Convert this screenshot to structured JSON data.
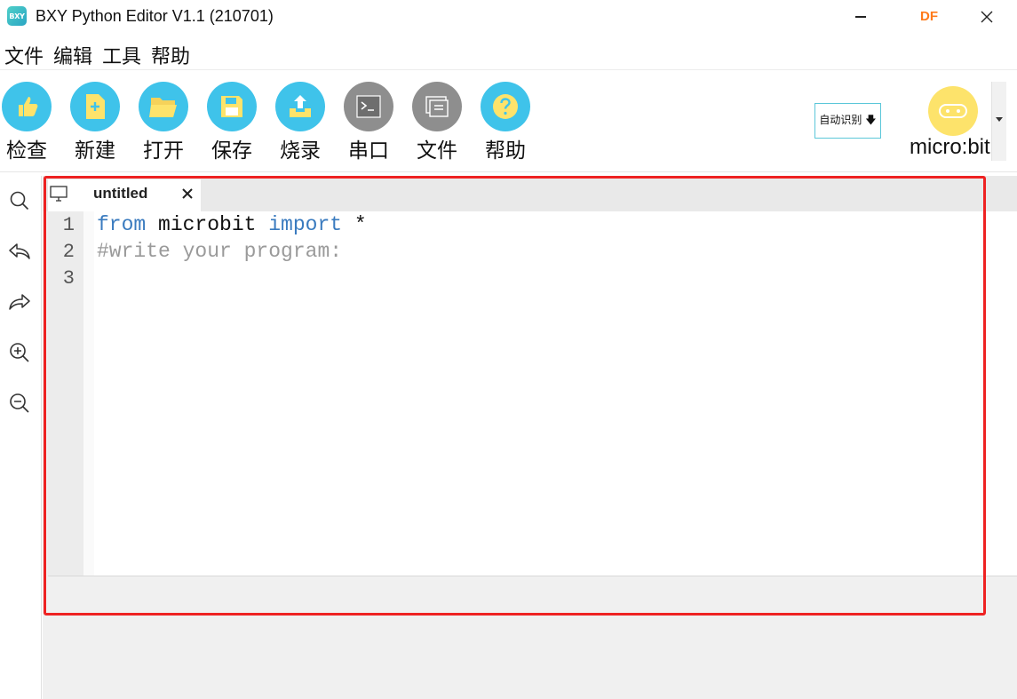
{
  "window": {
    "title": "BXY Python Editor V1.1 (210701)",
    "logo_text": "BXY",
    "badge_text": "DF"
  },
  "menu": {
    "items": [
      {
        "label": "文件"
      },
      {
        "label": "编辑"
      },
      {
        "label": "工具"
      },
      {
        "label": "帮助"
      }
    ]
  },
  "toolbar": {
    "buttons": [
      {
        "label": "检查",
        "icon": "thumbs-up-icon",
        "color": "#3fc3ea"
      },
      {
        "label": "新建",
        "icon": "new-file-icon",
        "color": "#3fc3ea"
      },
      {
        "label": "打开",
        "icon": "folder-open-icon",
        "color": "#3fc3ea"
      },
      {
        "label": "保存",
        "icon": "save-icon",
        "color": "#3fc3ea"
      },
      {
        "label": "烧录",
        "icon": "upload-icon",
        "color": "#3fc3ea"
      },
      {
        "label": "串口",
        "icon": "terminal-icon",
        "color": "#8e8e8e"
      },
      {
        "label": "文件",
        "icon": "files-icon",
        "color": "#8e8e8e"
      },
      {
        "label": "帮助",
        "icon": "help-icon",
        "color": "#3fc3ea"
      }
    ],
    "auto_detect_label": "自动识别 🡇",
    "board_label": "micro:bit"
  },
  "sidebar": {
    "tools": [
      "search-icon",
      "undo-icon",
      "redo-icon",
      "zoom-in-icon",
      "zoom-out-icon"
    ]
  },
  "editor": {
    "tab_title": "untitled",
    "line_numbers": [
      "1",
      "2",
      "3"
    ],
    "lines": {
      "l1_kw1": "from",
      "l1_mod": " microbit ",
      "l1_kw2": "import",
      "l1_rest": " *",
      "l2_comment": "#write your program:"
    }
  },
  "colors": {
    "accent_blue": "#3fc3ea",
    "keyword": "#3a7bbf",
    "comment": "#9a9a9a",
    "highlight_border": "#ee2222",
    "board_yellow": "#fde36b"
  }
}
